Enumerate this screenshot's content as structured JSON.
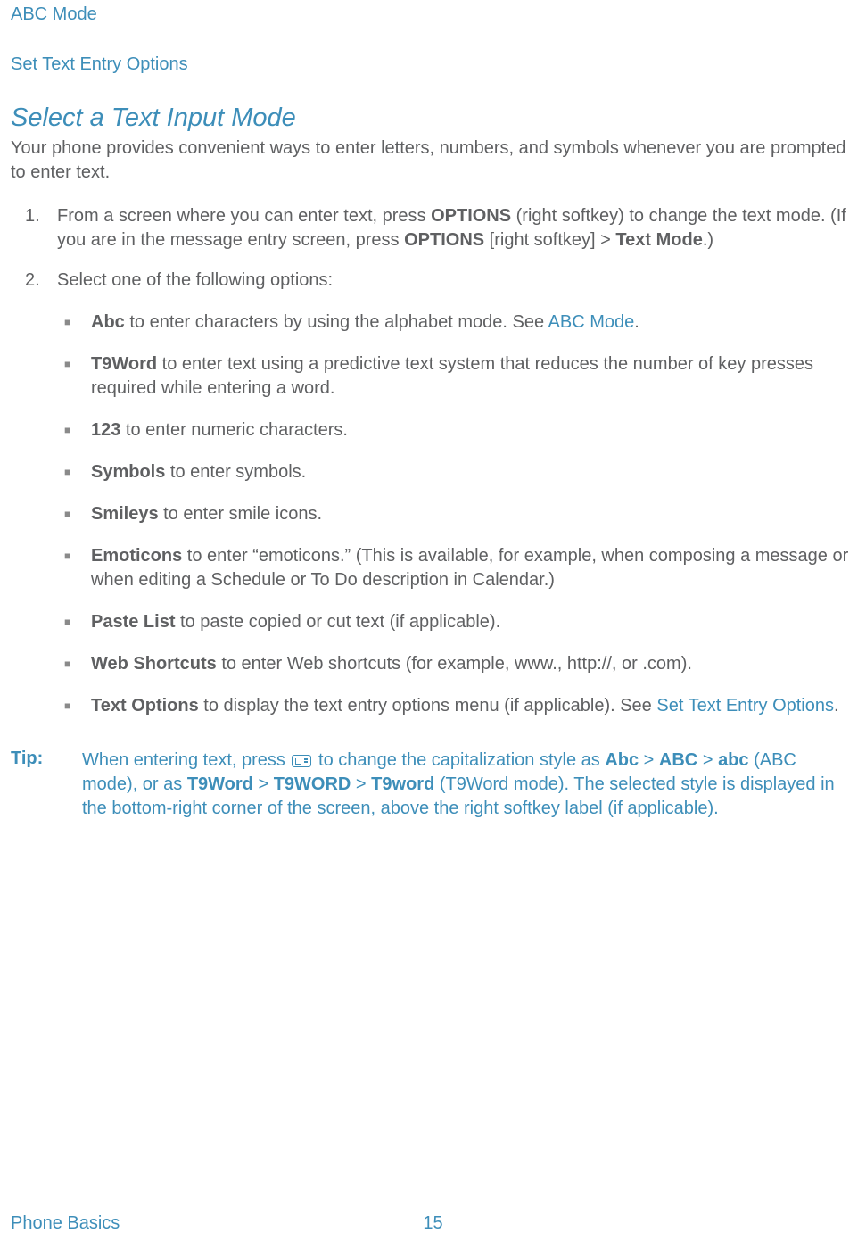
{
  "top_links": {
    "line1": "ABC Mode",
    "line2": "Set Text Entry Options"
  },
  "section_title": "Select a Text Input Mode",
  "intro": "Your phone provides convenient ways to enter letters, numbers, and symbols whenever you are prompted to enter text.",
  "step1": {
    "num": "1.",
    "pre": "From a screen where you can enter text, press ",
    "b1": "OPTIONS",
    "mid1": " (right softkey) to change the text mode. (If you are in the message entry screen, press ",
    "b2": "OPTIONS",
    "mid2": " [right softkey] > ",
    "b3": "Text Mode",
    "post": ".)"
  },
  "step2": {
    "num": "2.",
    "text": "Select one of the following options:"
  },
  "options": {
    "abc": {
      "b": "Abc",
      "t": " to enter characters by using the alphabet mode. See ",
      "link": "ABC Mode",
      "post": "."
    },
    "t9": {
      "b": "T9Word",
      "t": " to enter text using a predictive text system that reduces the number of key presses required while entering a word."
    },
    "n123": {
      "b": "123",
      "t": " to enter numeric characters."
    },
    "sym": {
      "b": "Symbols",
      "t": " to enter symbols."
    },
    "smi": {
      "b": "Smileys",
      "t": " to enter smile icons."
    },
    "emo": {
      "b": "Emoticons",
      "t": " to enter “emoticons.” (This is available, for example, when composing a message or when editing a Schedule or To Do description in Calendar.)"
    },
    "paste": {
      "b": "Paste List",
      "t": " to paste copied or cut text (if applicable)."
    },
    "web": {
      "b": "Web Shortcuts",
      "t": " to enter Web shortcuts (for example, www., http://, or .com)."
    },
    "topt": {
      "b": "Text Options",
      "t": " to display the text entry options menu (if applicable). See ",
      "link": "Set Text Entry Options",
      "post": "."
    }
  },
  "tip": {
    "label": "Tip:",
    "p1": "When entering text, press ",
    "p2": " to change the capitalization style as ",
    "b1": "Abc",
    "gt1": " > ",
    "b2": "ABC",
    "gt2": " > ",
    "b3": "abc",
    "p3": " (ABC mode), or as ",
    "b4": "T9Word",
    "gt3": " > ",
    "b5": "T9WORD",
    "gt4": " > ",
    "b6": "T9word",
    "p4": " (T9Word mode). The selected style is displayed in the bottom-right corner of the screen, above the right softkey label (if applicable)."
  },
  "footer": {
    "left": "Phone Basics",
    "page": "15"
  }
}
